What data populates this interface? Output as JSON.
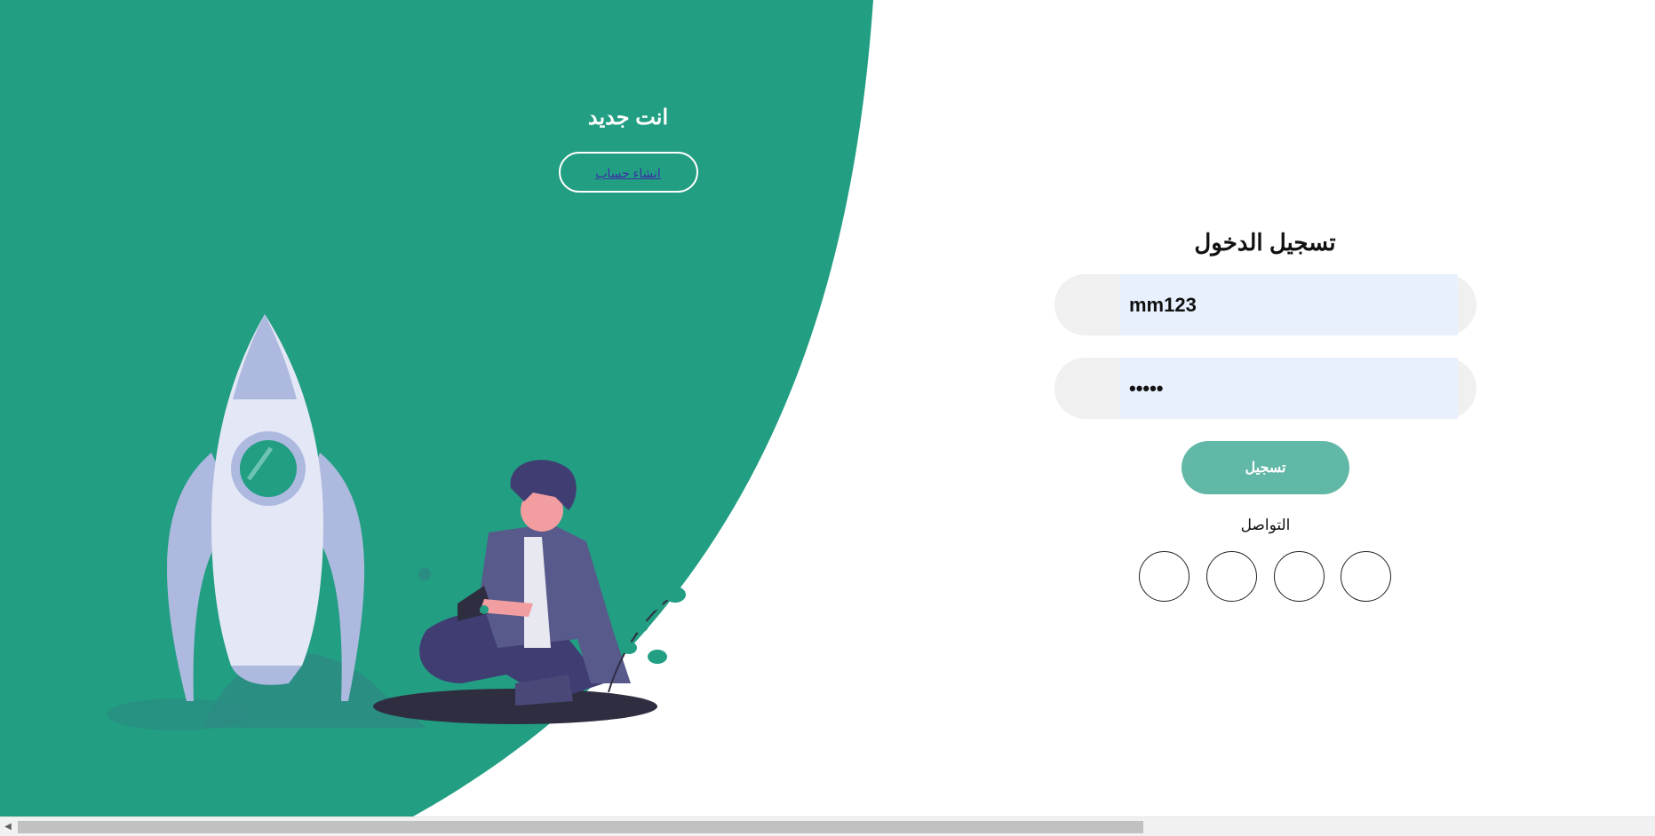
{
  "colors": {
    "panel_green": "#229e83",
    "button_green": "#62b8a6",
    "field_bg": "#f0f0f0",
    "autofill_bg": "#e8f0fe"
  },
  "left_panel": {
    "title": "انت جديد",
    "signup_link": "انشاء حساب"
  },
  "login_form": {
    "title": "تسجيل الدخول",
    "username_value": "mm123",
    "password_value": "•••••",
    "submit_label": "تسجيل",
    "social_label": "التواصل",
    "social_buttons": [
      "social-1",
      "social-2",
      "social-3",
      "social-4"
    ]
  },
  "icons": {
    "scroll_left": "scroll-left-arrow-icon",
    "scroll_left_glyph": "◀"
  }
}
